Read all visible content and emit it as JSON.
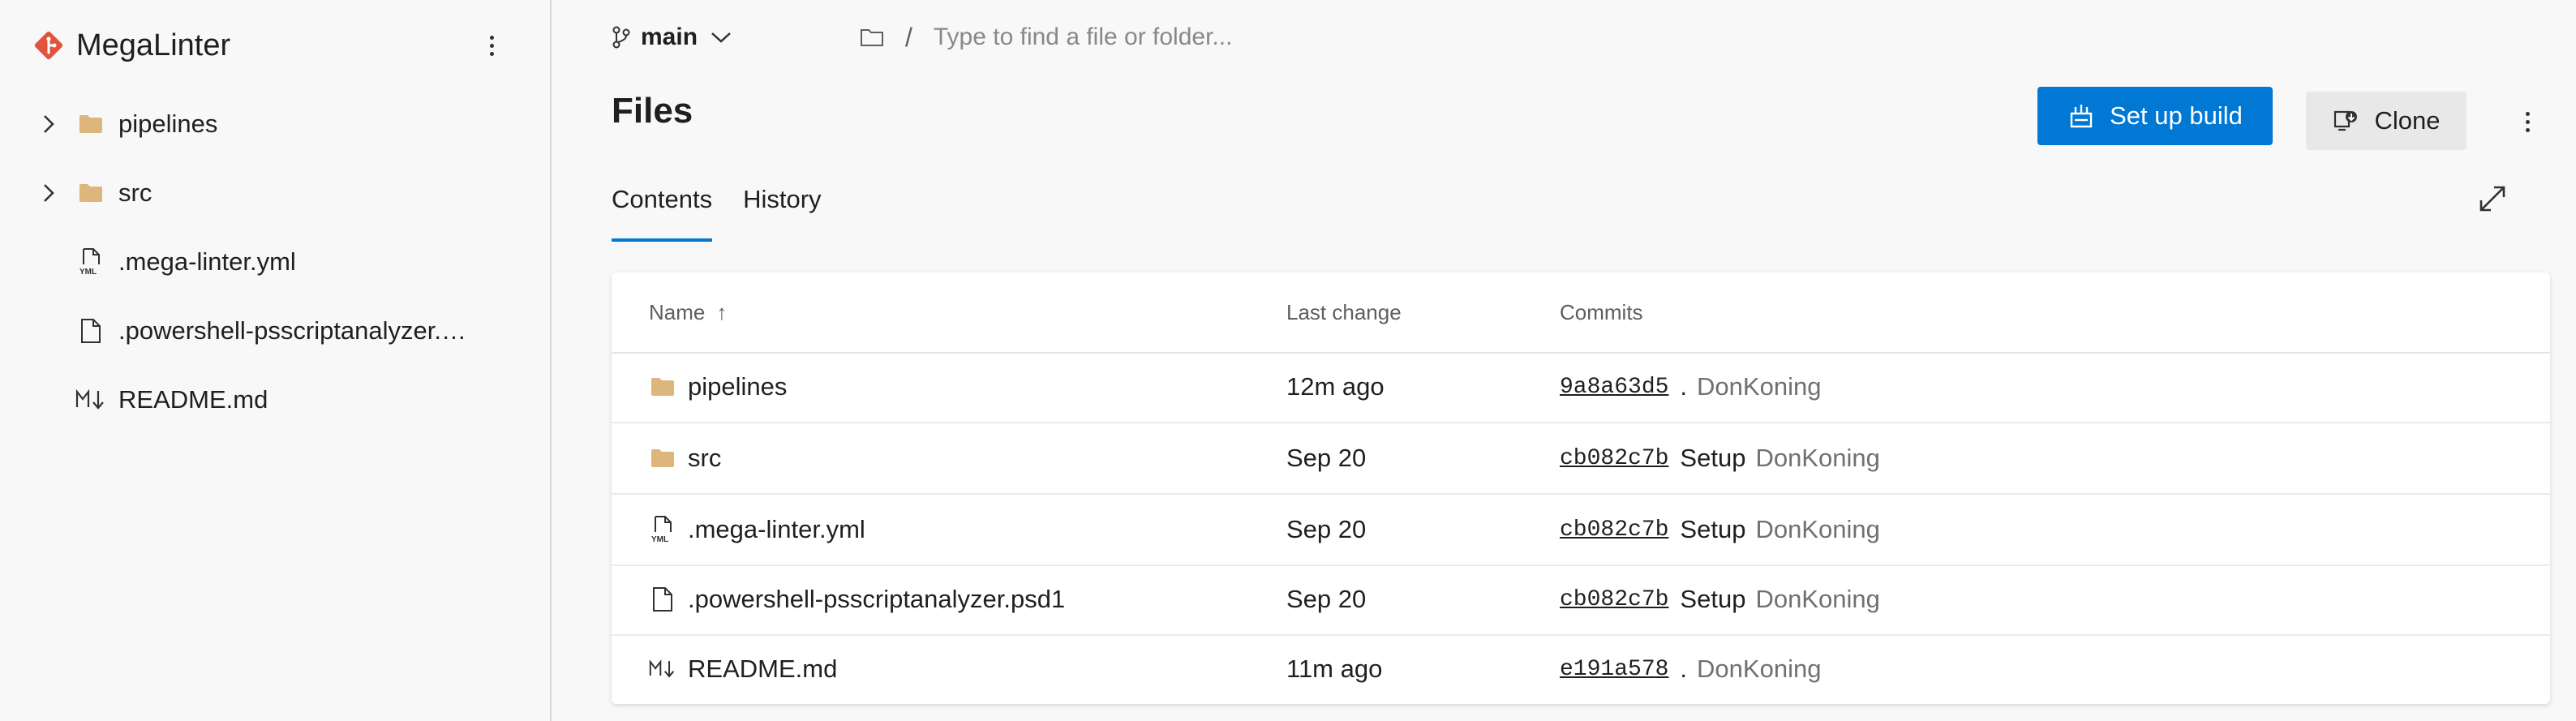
{
  "colors": {
    "accent": "#0078d4",
    "folder": "#dcb67a",
    "logo": "#e0533d"
  },
  "sidebar": {
    "repo_name": "MegaLinter",
    "items": [
      {
        "label": "pipelines",
        "icon": "folder-icon",
        "expandable": true
      },
      {
        "label": "src",
        "icon": "folder-icon",
        "expandable": true
      },
      {
        "label": ".mega-linter.yml",
        "icon": "yaml-file-icon",
        "expandable": false
      },
      {
        "label": ".powershell-psscriptanalyzer.psd1",
        "icon": "file-icon",
        "expandable": false
      },
      {
        "label": "README.md",
        "icon": "markdown-icon",
        "expandable": false
      }
    ]
  },
  "header": {
    "branch": "main",
    "path_separator": "/",
    "search_placeholder": "Type to find a file or folder..."
  },
  "main": {
    "title": "Files",
    "setup_build_label": "Set up build",
    "clone_label": "Clone",
    "tabs": [
      {
        "label": "Contents",
        "active": true
      },
      {
        "label": "History",
        "active": false
      }
    ]
  },
  "table": {
    "columns": {
      "name": "Name",
      "last_change": "Last change",
      "commits": "Commits"
    },
    "sort_indicator": "↑",
    "rows": [
      {
        "name": "pipelines",
        "icon": "folder-icon",
        "last_change": "12m ago",
        "commit": "9a8a63d5",
        "message": ".",
        "author": "DonKoning"
      },
      {
        "name": "src",
        "icon": "folder-icon",
        "last_change": "Sep 20",
        "commit": "cb082c7b",
        "message": "Setup",
        "author": "DonKoning"
      },
      {
        "name": ".mega-linter.yml",
        "icon": "yaml-file-icon",
        "last_change": "Sep 20",
        "commit": "cb082c7b",
        "message": "Setup",
        "author": "DonKoning"
      },
      {
        "name": ".powershell-psscriptanalyzer.psd1",
        "icon": "file-icon",
        "last_change": "Sep 20",
        "commit": "cb082c7b",
        "message": "Setup",
        "author": "DonKoning"
      },
      {
        "name": "README.md",
        "icon": "markdown-icon",
        "last_change": "11m ago",
        "commit": "e191a578",
        "message": ".",
        "author": "DonKoning"
      }
    ]
  }
}
